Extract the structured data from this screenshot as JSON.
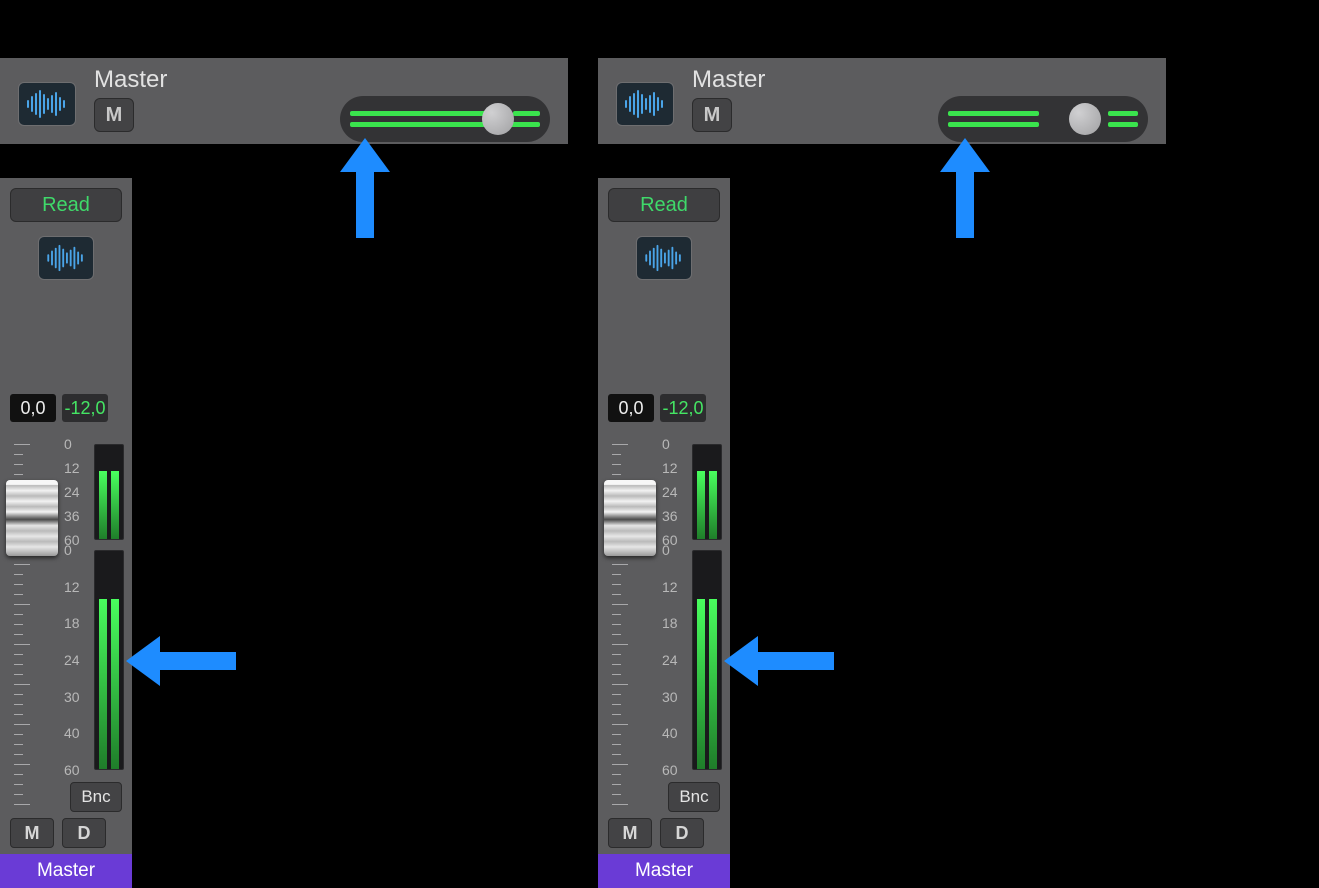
{
  "left": {
    "header": {
      "title": "Master",
      "mute_label": "M",
      "slider_fill_pct": 80,
      "slider_fill_pct_bot": 88,
      "thumb_pct": 78,
      "right_bar_start_pct": 86,
      "right_bar_show": true
    },
    "strip": {
      "read_label": "Read",
      "level_label": "0,0",
      "peak_label": "-12,0",
      "top_meter": {
        "scale_labels": [
          "0",
          "12",
          "24",
          "36",
          "60"
        ],
        "fill_pct": 72
      },
      "main_meter": {
        "scale_labels": [
          "0",
          "12",
          "18",
          "24",
          "30",
          "40",
          "60"
        ],
        "fill_pct": 78
      },
      "bnc_label": "Bnc",
      "mute_label": "M",
      "dim_label": "D",
      "master_label": "Master"
    }
  },
  "right": {
    "header": {
      "title": "Master",
      "mute_label": "M",
      "slider_fill_pct": 48,
      "slider_fill_pct_bot": 48,
      "thumb_pct": 72,
      "right_bar_start_pct": 84,
      "right_bar_show": true
    },
    "strip": {
      "read_label": "Read",
      "level_label": "0,0",
      "peak_label": "-12,0",
      "top_meter": {
        "scale_labels": [
          "0",
          "12",
          "24",
          "36",
          "60"
        ],
        "fill_pct": 72
      },
      "main_meter": {
        "scale_labels": [
          "0",
          "12",
          "18",
          "24",
          "30",
          "40",
          "60"
        ],
        "fill_pct": 78
      },
      "bnc_label": "Bnc",
      "mute_label": "M",
      "dim_label": "D",
      "master_label": "Master"
    }
  }
}
